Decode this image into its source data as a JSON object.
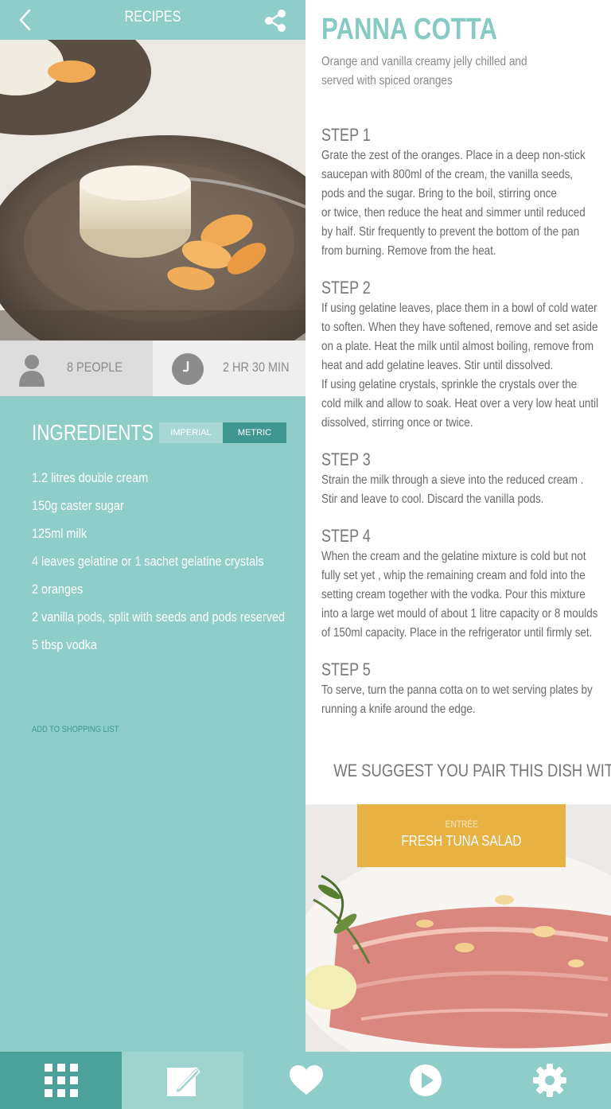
{
  "header": {
    "title": "RECIPES",
    "back_icon": "chevron-left-icon",
    "share_icon": "share-icon"
  },
  "recipe": {
    "title": "PANNA COTTA",
    "subtitle_lines": [
      "Orange and vanilla creamy jelly chilled and",
      "served with spiced oranges"
    ],
    "servings": "8 PEOPLE",
    "time": "2 HR 30 MIN"
  },
  "ingredients": {
    "title": "INGREDIENTS",
    "unit_options": [
      "IMPERIAL",
      "METRIC"
    ],
    "selected_unit": "METRIC",
    "items": [
      "1.2 litres double cream",
      "150g caster sugar",
      "125ml milk",
      "4 leaves gelatine or 1 sachet gelatine crystals",
      "2 oranges",
      "2 vanilla pods, split with seeds and pods reserved",
      "5 tbsp vodka"
    ],
    "shopping_link": "ADD TO SHOPPING LIST"
  },
  "steps": [
    {
      "title": "STEP 1",
      "lines": [
        "Grate the zest of the oranges. Place in a deep non-stick",
        "saucepan with 800ml  of the cream, the vanilla seeds,",
        "pods and the sugar. Bring to the boil, stirring once",
        "or twice, then reduce the heat and simmer until reduced",
        "by half. Stir frequently to prevent the bottom of the pan",
        "from burning. Remove from the heat."
      ]
    },
    {
      "title": "STEP 2",
      "lines": [
        "If using gelatine leaves, place them in a bowl of cold water",
        "to soften. When they have softened, remove and set aside",
        "on a plate. Heat the milk until almost boiling, remove from",
        "heat and add gelatine leaves. Stir until dissolved.",
        "If using gelatine crystals, sprinkle the crystals over the",
        "cold milk and allow to soak. Heat over a very low heat until",
        "dissolved, stirring once or twice."
      ]
    },
    {
      "title": "STEP 3",
      "lines": [
        "Strain the milk through a sieve into the reduced cream .",
        "Stir and leave to cool. Discard the vanilla pods."
      ]
    },
    {
      "title": "STEP 4",
      "lines": [
        "When the cream and the gelatine mixture is cold but not",
        "fully set yet , whip the remaining cream and fold into the",
        "setting cream together with the vodka. Pour this mixture",
        "into a large wet mould of about 1 litre  capacity or 8 moulds",
        "of 150ml capacity. Place in the refrigerator until firmly set."
      ]
    },
    {
      "title": "STEP 5",
      "lines": [
        "To serve, turn the panna cotta on to wet serving plates by",
        "running a knife around the edge."
      ]
    }
  ],
  "pairing": {
    "heading": "WE SUGGEST YOU PAIR THIS  DISH WITH:",
    "course": "ENTRÉE",
    "dish": "FRESH TUNA SALAD"
  },
  "bottom_nav": [
    {
      "icon": "grid-icon",
      "selected": true
    },
    {
      "icon": "notes-icon",
      "selected": false
    },
    {
      "icon": "heart-icon",
      "selected": false
    },
    {
      "icon": "play-icon",
      "selected": false
    },
    {
      "icon": "gear-icon",
      "selected": false
    }
  ],
  "colors": {
    "accent": "#8ecdc8",
    "accent_dark": "#3f978f",
    "nav_selected": "#4aa199",
    "pairing_banner": "#e7b144"
  }
}
